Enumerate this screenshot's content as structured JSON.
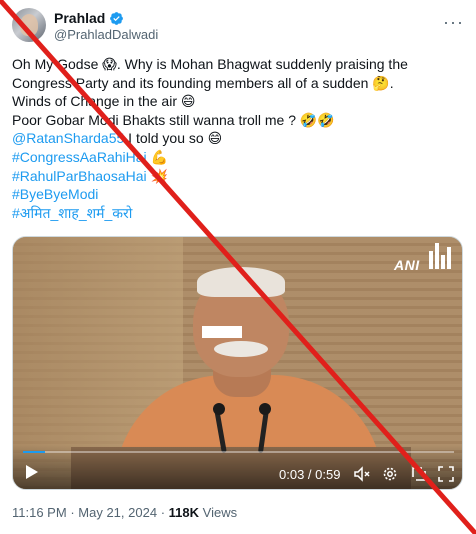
{
  "author": {
    "name": "Prahlad",
    "handle": "@PrahladDalwadi"
  },
  "tweet": {
    "lines": [
      "Oh My Godse 😱. Why is Mohan Bhagwat suddenly praising the",
      "Congress Party and its founding members all of a sudden 🤔.",
      "Winds of Change in the air 😄",
      "Poor Gobar Modi Bhakts still wanna troll me ? 🤣🤣"
    ],
    "mention": "@RatanSharda55",
    "mention_rest": " I told you so 😄",
    "hashtags": [
      "#CongressAaRahiHai 💪",
      "#RahulParBhaosaHai 💥",
      "#ByeByeModi",
      "#अमित_शाह_शर्म_करो"
    ]
  },
  "video": {
    "watermark": "ANI",
    "time": "0:03 / 0:59",
    "progress": 0.05
  },
  "meta": {
    "time": "11:16 PM",
    "date": "May 21, 2024",
    "views_count": "118K",
    "views_label": "Views",
    "separator": "·"
  },
  "colors": {
    "accent": "#1d9bf0",
    "strike": "#e0201b",
    "text": "#0f1419",
    "muted": "#536471"
  }
}
